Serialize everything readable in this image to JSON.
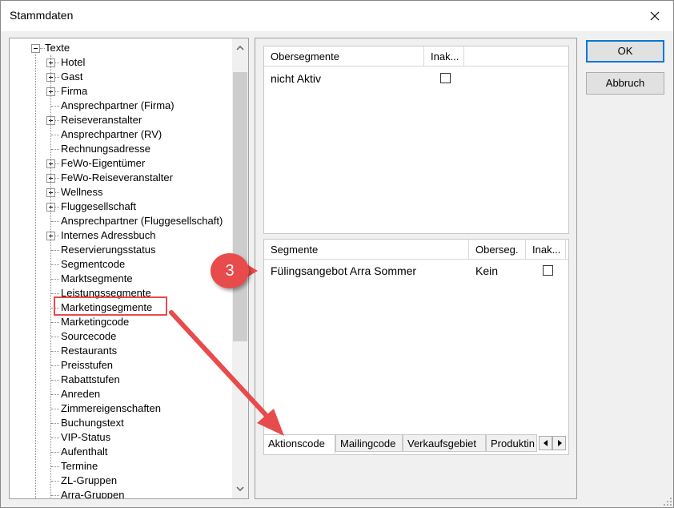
{
  "window": {
    "title": "Stammdaten"
  },
  "tree": {
    "root_label": "Texte",
    "items": [
      {
        "label": "Hotel",
        "expandable": true
      },
      {
        "label": "Gast",
        "expandable": true
      },
      {
        "label": "Firma",
        "expandable": true
      },
      {
        "label": "Ansprechpartner (Firma)",
        "expandable": false
      },
      {
        "label": "Reiseveranstalter",
        "expandable": true
      },
      {
        "label": "Ansprechpartner (RV)",
        "expandable": false
      },
      {
        "label": "Rechnungsadresse",
        "expandable": false
      },
      {
        "label": "FeWo-Eigentümer",
        "expandable": true
      },
      {
        "label": "FeWo-Reiseveranstalter",
        "expandable": true
      },
      {
        "label": "Wellness",
        "expandable": true
      },
      {
        "label": "Fluggesellschaft",
        "expandable": true
      },
      {
        "label": "Ansprechpartner (Fluggesellschaft)",
        "expandable": false
      },
      {
        "label": "Internes Adressbuch",
        "expandable": true
      },
      {
        "label": "Reservierungsstatus",
        "expandable": false
      },
      {
        "label": "Segmentcode",
        "expandable": false
      },
      {
        "label": "Marktsegmente",
        "expandable": false
      },
      {
        "label": "Leistungssegmente",
        "expandable": false
      },
      {
        "label": "Marketingsegmente",
        "expandable": false,
        "highlighted": true
      },
      {
        "label": "Marketingcode",
        "expandable": false
      },
      {
        "label": "Sourcecode",
        "expandable": false
      },
      {
        "label": "Restaurants",
        "expandable": false
      },
      {
        "label": "Preisstufen",
        "expandable": false
      },
      {
        "label": "Rabattstufen",
        "expandable": false
      },
      {
        "label": "Anreden",
        "expandable": false
      },
      {
        "label": "Zimmereigenschaften",
        "expandable": false
      },
      {
        "label": "Buchungstext",
        "expandable": false
      },
      {
        "label": "VIP-Status",
        "expandable": false
      },
      {
        "label": "Aufenthalt",
        "expandable": false
      },
      {
        "label": "Termine",
        "expandable": false
      },
      {
        "label": "ZL-Gruppen",
        "expandable": false
      },
      {
        "label": "Arra-Gruppen",
        "expandable": false
      }
    ]
  },
  "obersegmente_grid": {
    "columns": [
      "Obersegmente",
      "Inak..."
    ],
    "rows": [
      {
        "name": "nicht Aktiv",
        "inaktiv": false
      }
    ]
  },
  "segmente_grid": {
    "columns": [
      "Segmente",
      "Oberseg.",
      "Inak..."
    ],
    "rows": [
      {
        "name": "Fülingsangebot Arra Sommer",
        "oberseg": "Kein",
        "inaktiv": false
      }
    ]
  },
  "tabs": [
    "Aktionscode",
    "Mailingcode",
    "Verkaufsgebiet",
    "Produktin"
  ],
  "active_tab": "Aktionscode",
  "buttons": {
    "ok": "OK",
    "cancel": "Abbruch"
  },
  "annotation": {
    "badge_number": "3",
    "color": "#e84b4b"
  },
  "colors": {
    "accent": "#0078d7",
    "annotation": "#e84b4b"
  }
}
